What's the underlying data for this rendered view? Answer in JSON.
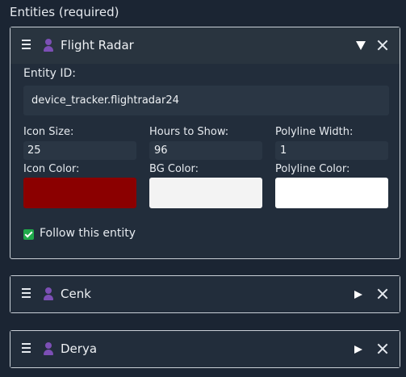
{
  "section_title": "Entities (required)",
  "entities": [
    {
      "name": "Flight Radar",
      "expanded": true,
      "entity_id_label": "Entity ID:",
      "entity_id": "device_tracker.flightradar24",
      "icon_size_label": "Icon Size:",
      "icon_size": "25",
      "hours_label": "Hours to Show:",
      "hours": "96",
      "polyline_width_label": "Polyline Width:",
      "polyline_width": "1",
      "icon_color_label": "Icon Color:",
      "icon_color": "#8b0000",
      "bg_color_label": "BG Color:",
      "bg_color": "#f3f3f3",
      "polyline_color_label": "Polyline Color:",
      "polyline_color": "#ffffff",
      "follow_label": "Follow this entity",
      "follow": true
    },
    {
      "name": "Cenk",
      "expanded": false
    },
    {
      "name": "Derya",
      "expanded": false
    }
  ],
  "icons": {
    "drag": "drag-handle-icon",
    "entity": "person-icon",
    "expanded": "triangle-down-icon",
    "collapsed": "triangle-right-icon",
    "close": "close-icon"
  },
  "colors": {
    "accent_check": "#1fa94a",
    "entity_icon": "#7c4fb5"
  }
}
